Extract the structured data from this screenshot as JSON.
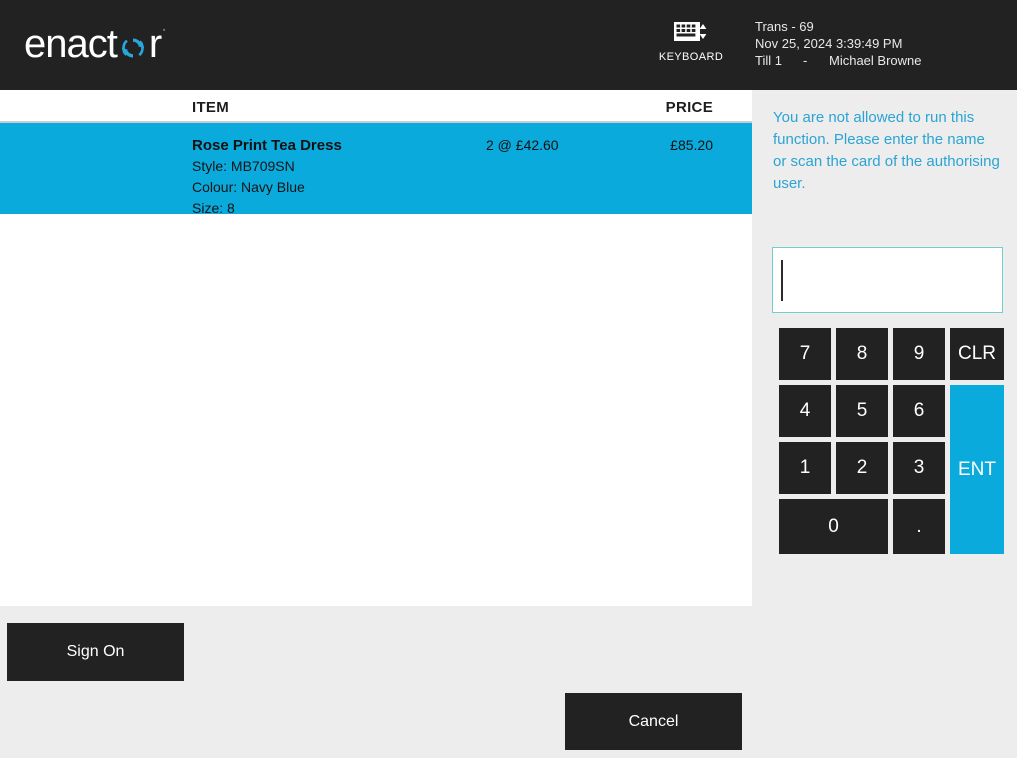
{
  "header": {
    "brand": {
      "text_before": "enact",
      "cycle_icon": "refresh-cycle-icon",
      "text_after": "r",
      "trademark": "·"
    },
    "keyboard_button": {
      "icon": "keyboard-icon",
      "label": "KEYBOARD"
    },
    "transaction": {
      "trans": "Trans - 69",
      "datetime": "Nov 25, 2024 3:39:49 PM",
      "till": "Till 1",
      "separator": "-",
      "operator": "Michael Browne"
    }
  },
  "receipt": {
    "columns": {
      "item": "ITEM",
      "price": "PRICE"
    },
    "lines": [
      {
        "name": "Rose Print Tea Dress",
        "style": "Style: MB709SN",
        "colour": "Colour: Navy Blue",
        "size": "Size: 8",
        "quantity_price": "2 @ £42.60",
        "amount": "£85.20",
        "selected": true
      }
    ]
  },
  "side_panel": {
    "message": "You are not allowed to run this function. Please enter the name or scan the card of the authorising user.",
    "auth_input": {
      "value": "",
      "placeholder": ""
    },
    "keypad": [
      {
        "label": "7",
        "name": "key-7"
      },
      {
        "label": "8",
        "name": "key-8"
      },
      {
        "label": "9",
        "name": "key-9"
      },
      {
        "label": "CLR",
        "name": "key-clear"
      },
      {
        "label": "4",
        "name": "key-4"
      },
      {
        "label": "5",
        "name": "key-5"
      },
      {
        "label": "6",
        "name": "key-6"
      },
      {
        "label": "1",
        "name": "key-1"
      },
      {
        "label": "2",
        "name": "key-2"
      },
      {
        "label": "3",
        "name": "key-3"
      },
      {
        "label": "0",
        "name": "key-0"
      },
      {
        "label": ".",
        "name": "key-decimal"
      },
      {
        "label": "ENT",
        "name": "key-enter"
      }
    ]
  },
  "actions": {
    "sign_on": "Sign On",
    "cancel": "Cancel"
  },
  "colors": {
    "accent_blue": "#0aaadd",
    "dark": "#222222",
    "panel_gray": "#ededed",
    "message_blue": "#2ba4d4",
    "input_border": "#6fcfcf"
  }
}
